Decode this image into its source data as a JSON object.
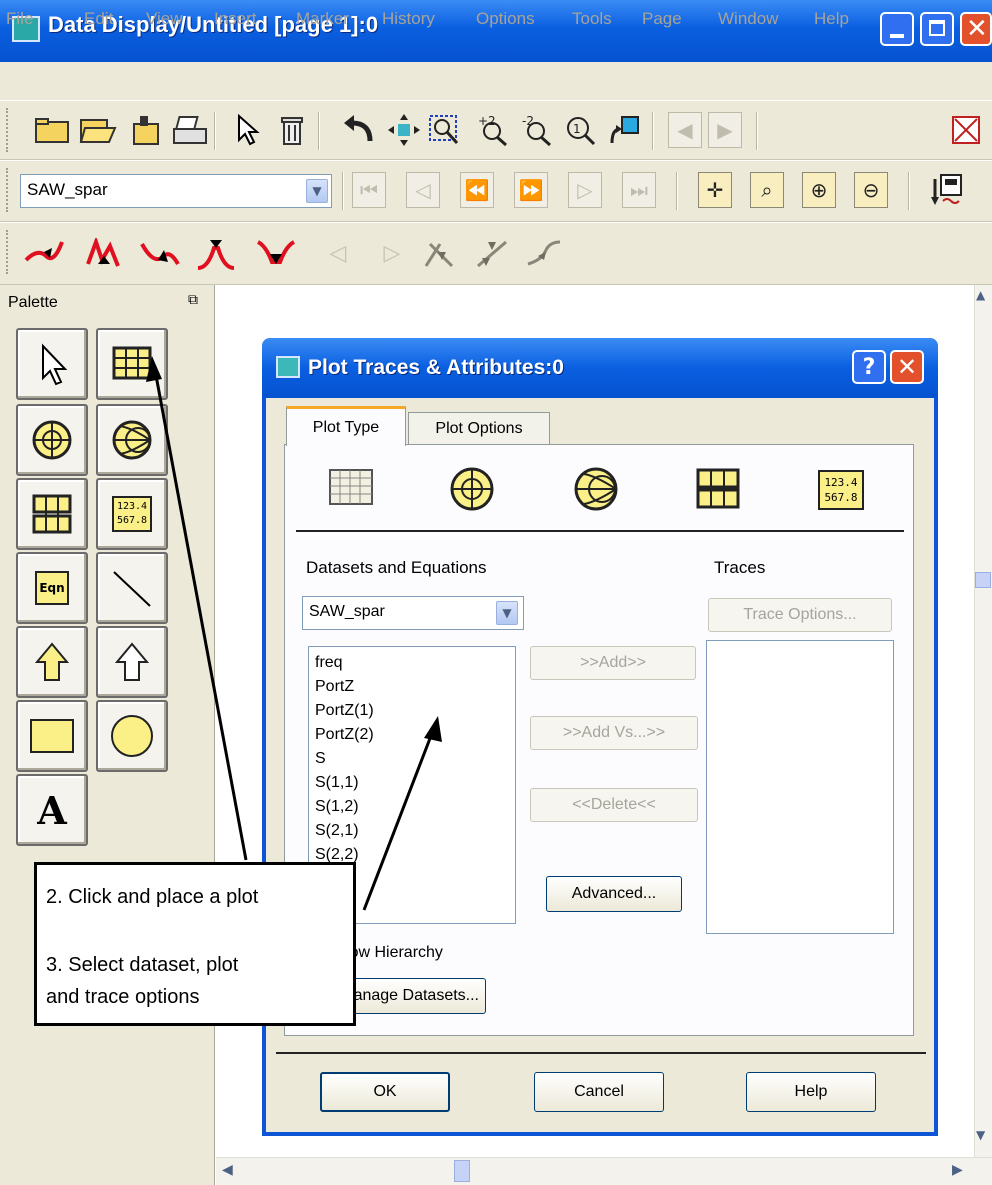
{
  "window": {
    "title": "Data Display/Untitled [page 1]:0"
  },
  "menu": [
    "File",
    "Edit",
    "View",
    "Insert",
    "Marker",
    "History",
    "Options",
    "Tools",
    "Page",
    "Window",
    "Help"
  ],
  "toolbar2": {
    "dataset_value": "SAW_spar"
  },
  "palette": {
    "title": "Palette",
    "table_label": "123.4 567.8",
    "eqn_label": "Eqn"
  },
  "dialog": {
    "title": "Plot Traces & Attributes:0",
    "tabs": [
      "Plot Type",
      "Plot Options"
    ],
    "datasets_label": "Datasets and Equations",
    "traces_label": "Traces",
    "dataset_value": "SAW_spar",
    "variables": [
      "freq",
      "PortZ",
      "PortZ(1)",
      "PortZ(2)",
      "S",
      "S(1,1)",
      "S(1,2)",
      "S(2,1)",
      "S(2,2)"
    ],
    "add_button": ">>Add>>",
    "add_vs_button": ">>Add Vs...>>",
    "delete_button": "<<Delete<<",
    "advanced_button": "Advanced...",
    "trace_options_button": "Trace Options...",
    "show_hierarchy_label": "Show Hierarchy",
    "manage_datasets_button": "Manage Datasets...",
    "ok_button": "OK",
    "cancel_button": "Cancel",
    "help_button": "Help",
    "table_icon_label": "123.4 567.8"
  },
  "callout": {
    "line1": "2. Click and place a plot",
    "line2": "3. Select dataset, plot",
    "line3": "and trace options"
  },
  "colors": {
    "title_blue": "#0a5fe0",
    "window_gray": "#ece9d8",
    "marker_red": "#e01020"
  },
  "icons": {
    "marker_tools": [
      "marker-icon",
      "valley-marker-icon",
      "min-marker-icon",
      "peak-marker-icon",
      "max-marker-icon"
    ]
  }
}
